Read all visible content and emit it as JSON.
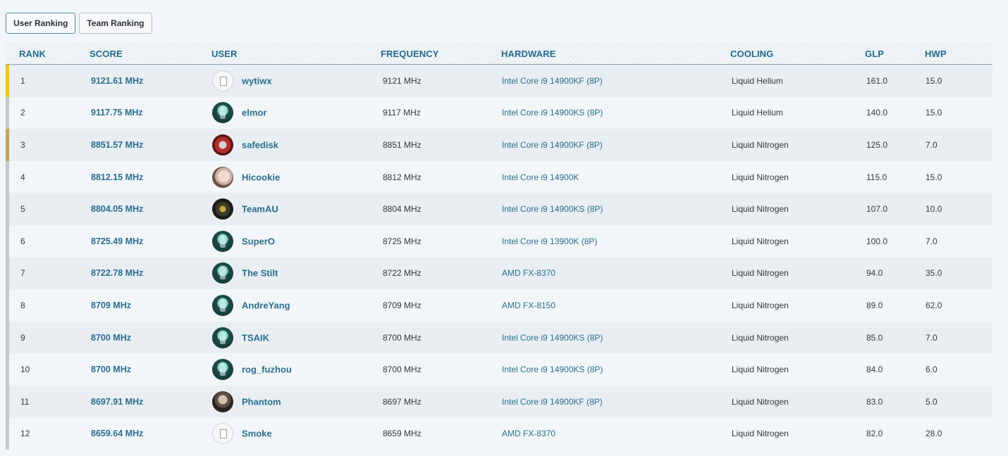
{
  "tabs": [
    {
      "label": "User Ranking",
      "active": true
    },
    {
      "label": "Team Ranking",
      "active": false
    }
  ],
  "columns": [
    "RANK",
    "SCORE",
    "USER",
    "FREQUENCY",
    "HARDWARE",
    "COOLING",
    "GLP",
    "HWP"
  ],
  "colors": {
    "accent": "#2a6d8f",
    "rank1_bar": "#f2c318",
    "rank3_bar": "#c7a25b",
    "default_bar": "#c6c9cc"
  },
  "rows": [
    {
      "rank": "1",
      "score": "9121.61 MHz",
      "user": "wytiwx",
      "avatar": "broken-image-icon",
      "frequency": "9121 MHz",
      "hardware": "Intel Core i9 14900KF (8P)",
      "cooling": "Liquid Helium",
      "glp": "161.0",
      "hwp": "15.0"
    },
    {
      "rank": "2",
      "score": "9117.75 MHz",
      "user": "elmor",
      "avatar": "mask-avatar",
      "frequency": "9117 MHz",
      "hardware": "Intel Core i9 14900KS (8P)",
      "cooling": "Liquid Helium",
      "glp": "140.0",
      "hwp": "15.0"
    },
    {
      "rank": "3",
      "score": "8851.57 MHz",
      "user": "safedisk",
      "avatar": "red-emblem-avatar",
      "frequency": "8851 MHz",
      "hardware": "Intel Core i9 14900KF (8P)",
      "cooling": "Liquid Nitrogen",
      "glp": "125.0",
      "hwp": "7.0"
    },
    {
      "rank": "4",
      "score": "8812.15 MHz",
      "user": "Hicookie",
      "avatar": "portrait-avatar",
      "frequency": "8812 MHz",
      "hardware": "Intel Core i9 14900K",
      "cooling": "Liquid Nitrogen",
      "glp": "115.0",
      "hwp": "15.0"
    },
    {
      "rank": "5",
      "score": "8804.05 MHz",
      "user": "TeamAU",
      "avatar": "team-logo-avatar",
      "frequency": "8804 MHz",
      "hardware": "Intel Core i9 14900KS (8P)",
      "cooling": "Liquid Nitrogen",
      "glp": "107.0",
      "hwp": "10.0"
    },
    {
      "rank": "6",
      "score": "8725.49 MHz",
      "user": "SuperO",
      "avatar": "mask-avatar",
      "frequency": "8725 MHz",
      "hardware": "Intel Core i9 13900K (8P)",
      "cooling": "Liquid Nitrogen",
      "glp": "100.0",
      "hwp": "7.0"
    },
    {
      "rank": "7",
      "score": "8722.78 MHz",
      "user": "The Stilt",
      "avatar": "mask-avatar",
      "frequency": "8722 MHz",
      "hardware": "AMD FX-8370",
      "cooling": "Liquid Nitrogen",
      "glp": "94.0",
      "hwp": "35.0"
    },
    {
      "rank": "8",
      "score": "8709 MHz",
      "user": "AndreYang",
      "avatar": "mask-avatar",
      "frequency": "8709 MHz",
      "hardware": "AMD FX-8150",
      "cooling": "Liquid Nitrogen",
      "glp": "89.0",
      "hwp": "62.0"
    },
    {
      "rank": "9",
      "score": "8700 MHz",
      "user": "TSAIK",
      "avatar": "mask-avatar",
      "frequency": "8700 MHz",
      "hardware": "Intel Core i9 14900KS (8P)",
      "cooling": "Liquid Nitrogen",
      "glp": "85.0",
      "hwp": "7.0"
    },
    {
      "rank": "10",
      "score": "8700 MHz",
      "user": "rog_fuzhou",
      "avatar": "mask-avatar",
      "frequency": "8700 MHz",
      "hardware": "Intel Core i9 14900KS (8P)",
      "cooling": "Liquid Nitrogen",
      "glp": "84.0",
      "hwp": "6.0"
    },
    {
      "rank": "11",
      "score": "8697.91 MHz",
      "user": "Phantom",
      "avatar": "portrait-avatar-dark",
      "frequency": "8697 MHz",
      "hardware": "Intel Core i9 14900KF (8P)",
      "cooling": "Liquid Nitrogen",
      "glp": "83.0",
      "hwp": "5.0"
    },
    {
      "rank": "12",
      "score": "8659.64 MHz",
      "user": "Smoke",
      "avatar": "broken-image-icon",
      "frequency": "8659 MHz",
      "hardware": "AMD FX-8370",
      "cooling": "Liquid Nitrogen",
      "glp": "82.0",
      "hwp": "28.0"
    }
  ]
}
